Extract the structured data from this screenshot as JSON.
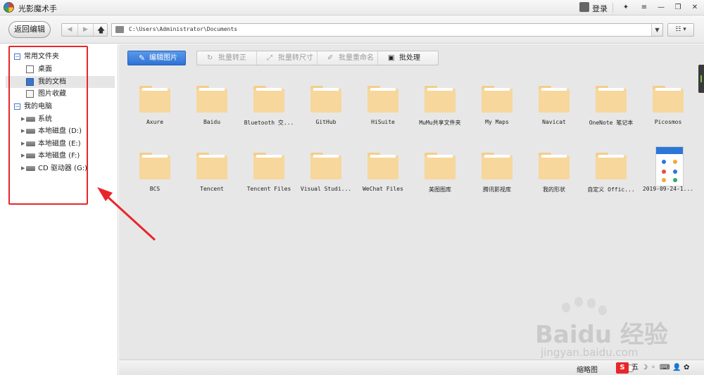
{
  "window": {
    "title": "光影魔术手",
    "login_label": "登录",
    "controls": [
      "✦",
      "≡",
      "—",
      "❐",
      "✕"
    ]
  },
  "navbar": {
    "back_button": "返回编辑",
    "path": "C:\\Users\\Administrator\\Documents"
  },
  "sidebar": {
    "favorites_header": "常用文件夹",
    "favorites": [
      "桌面",
      "我的文档",
      "图片收藏"
    ],
    "computer_header": "我的电脑",
    "drives": [
      "系统",
      "本地磁盘 (D:)",
      "本地磁盘 (E:)",
      "本地磁盘 (F:)",
      "CD 驱动器 (G:)"
    ],
    "selected": "我的文档"
  },
  "toolbar": {
    "edit_image": "编辑图片",
    "batch_convert": "批量转正",
    "batch_resize": "批量转尺寸",
    "batch_rename": "批量重命名",
    "batch_process": "批处理"
  },
  "files": {
    "row1": [
      "Axure",
      "Baidu",
      "Bluetooth 交...",
      "GitHub",
      "HiSuite",
      "MuMu共享文件夹",
      "My Maps",
      "Navicat",
      "OneNote 笔记本",
      "Picosmos"
    ],
    "row2": [
      "BCS",
      "Tencent",
      "Tencent Files",
      "Visual Studi...",
      "WeChat Files",
      "美图图库",
      "腾讯影视库",
      "我的形状",
      "自定义 Offic...",
      "2019-09-24-1..."
    ]
  },
  "statusbar": {
    "thumbnail_label": "缩略图",
    "zoom_fraction": 0.2,
    "ime": [
      "S",
      "五",
      "☽",
      "◦",
      "⌨",
      "👤",
      "✿"
    ]
  },
  "watermark": {
    "logo": "Baidu 经验",
    "url": "jingyan.baidu.com"
  },
  "colors": {
    "accent_blue": "#2f72d6",
    "annotation_red": "#e8262a",
    "folder_yellow": "#f7d79b"
  }
}
